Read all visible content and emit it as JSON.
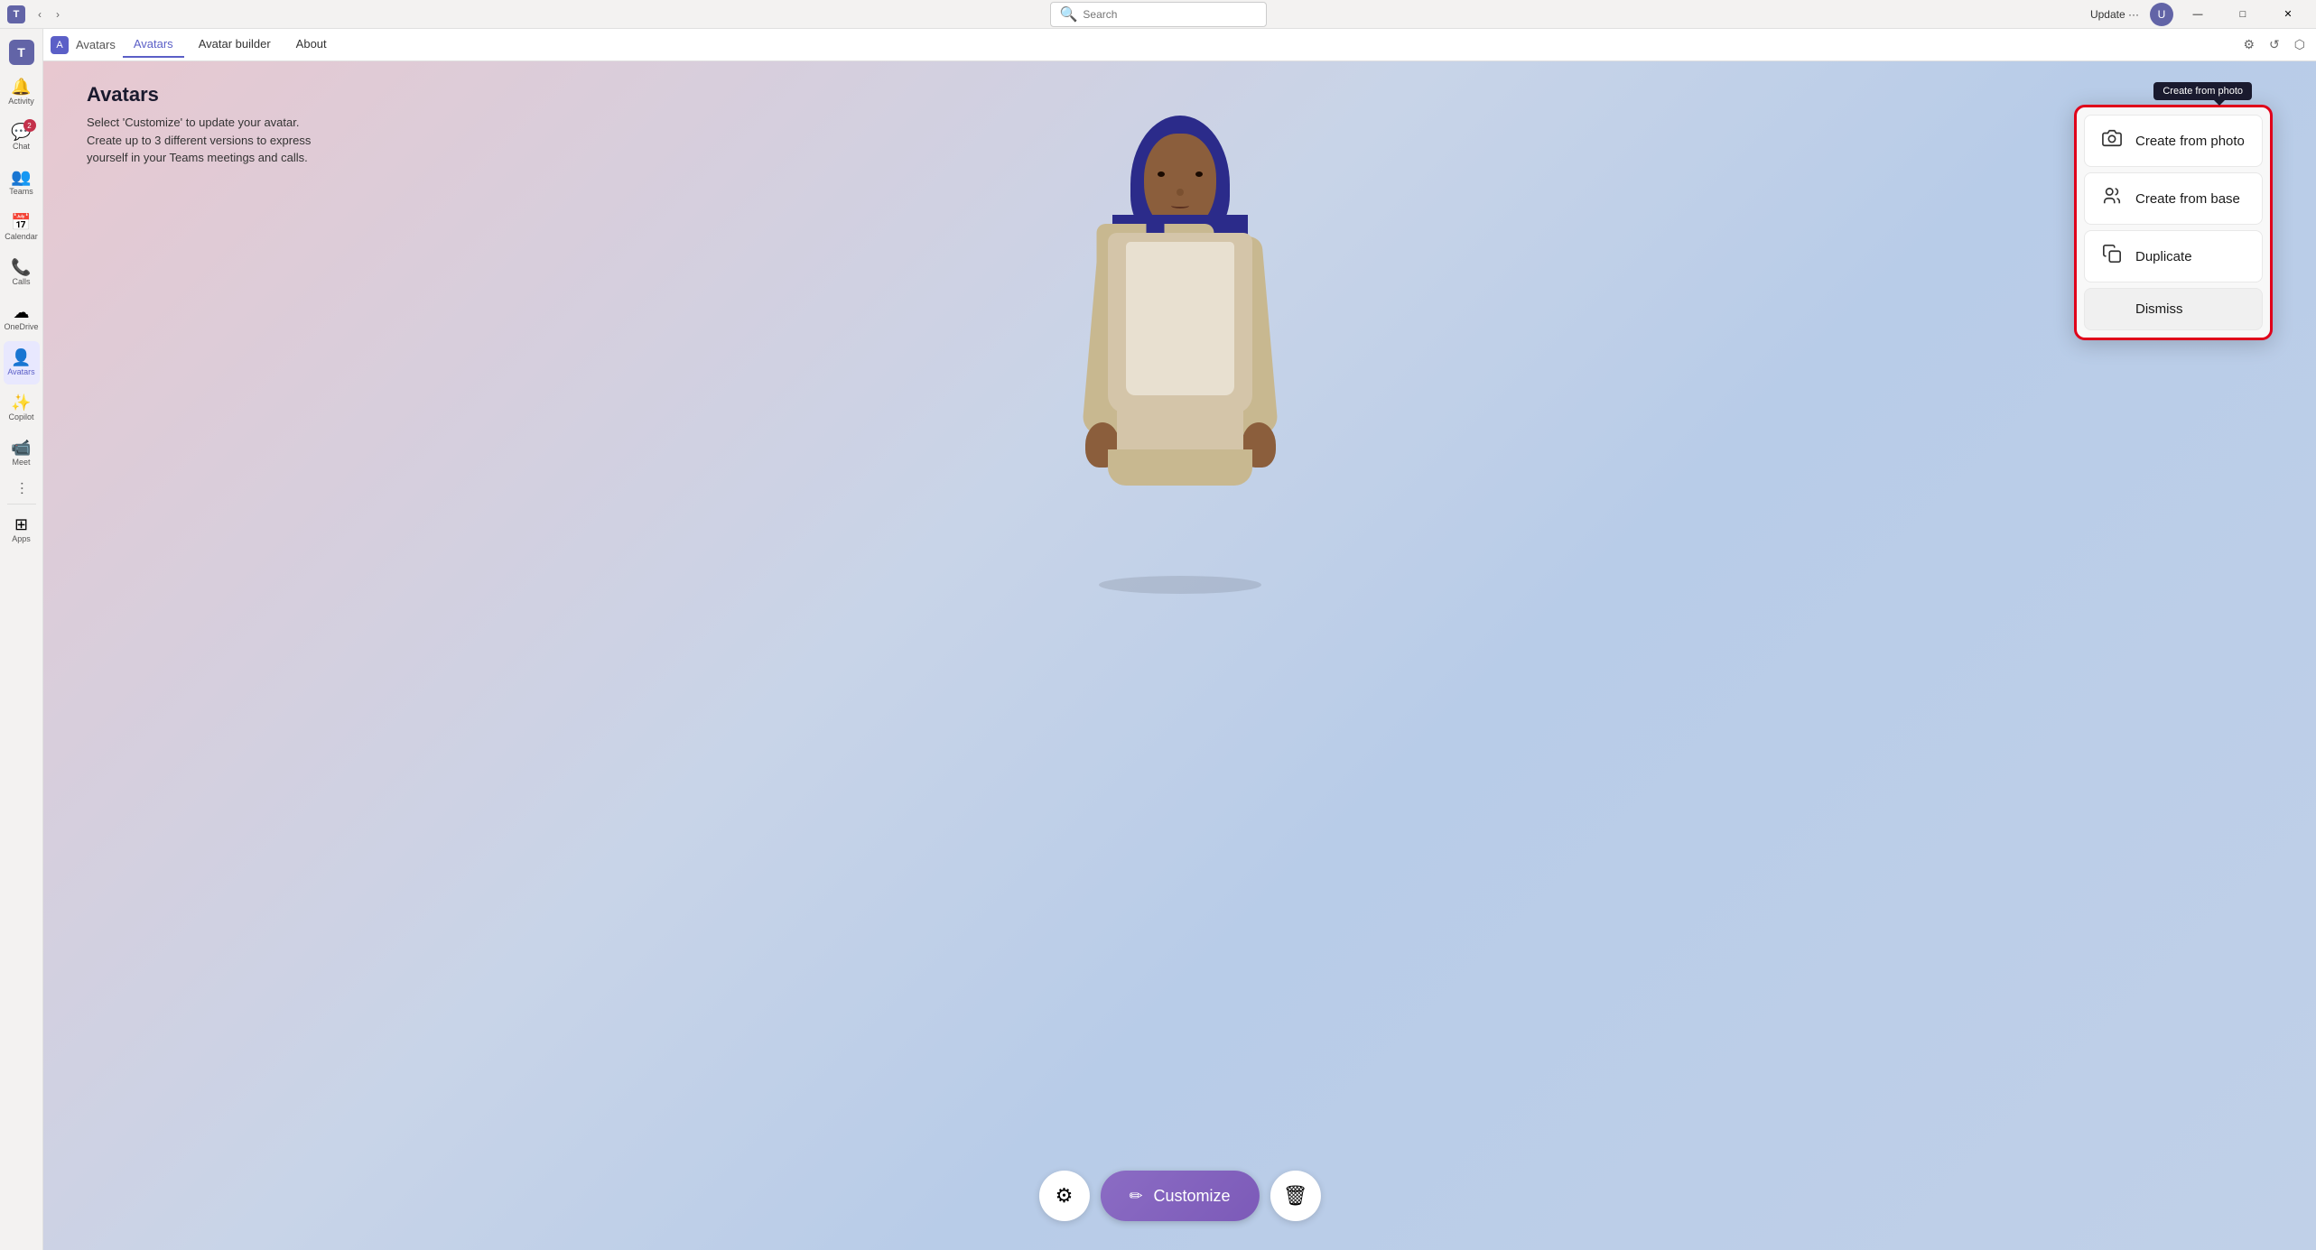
{
  "titleBar": {
    "updateLabel": "Update ···",
    "backLabel": "‹",
    "forwardLabel": "›",
    "searchPlaceholder": "Search",
    "minimizeLabel": "—",
    "maximizeLabel": "□",
    "closeLabel": "✕"
  },
  "sidebar": {
    "items": [
      {
        "id": "app-icon",
        "icon": "🪟",
        "label": "",
        "badge": null
      },
      {
        "id": "activity",
        "icon": "🔔",
        "label": "Activity",
        "badge": null
      },
      {
        "id": "chat",
        "icon": "💬",
        "label": "Chat",
        "badge": "2"
      },
      {
        "id": "teams",
        "icon": "👥",
        "label": "Teams",
        "badge": null
      },
      {
        "id": "calendar",
        "icon": "📅",
        "label": "Calendar",
        "badge": null
      },
      {
        "id": "calls",
        "icon": "📞",
        "label": "Calls",
        "badge": null
      },
      {
        "id": "onedrive",
        "icon": "☁",
        "label": "OneDrive",
        "badge": null
      },
      {
        "id": "avatars",
        "icon": "👤",
        "label": "Avatars",
        "badge": null,
        "active": true
      },
      {
        "id": "copilot",
        "icon": "✨",
        "label": "Copilot",
        "badge": null
      },
      {
        "id": "meet",
        "icon": "📹",
        "label": "Meet",
        "badge": null
      },
      {
        "id": "apps",
        "icon": "⊞",
        "label": "Apps",
        "badge": null
      }
    ]
  },
  "tabs": {
    "breadcrumb": "Avatars",
    "items": [
      {
        "id": "avatars-tab",
        "label": "Avatars",
        "active": true
      },
      {
        "id": "avatar-builder-tab",
        "label": "Avatar builder",
        "active": false
      },
      {
        "id": "about-tab",
        "label": "About",
        "active": false
      }
    ]
  },
  "page": {
    "title": "Avatars",
    "description": "Select 'Customize' to update your avatar.\nCreate up to 3 different versions to express\nyourself in your Teams meetings and calls."
  },
  "toolbar": {
    "settingsLabel": "⚙",
    "customizeLabel": "Customize",
    "customizeIcon": "✏",
    "deleteLabel": "🗑"
  },
  "contextMenu": {
    "tooltip": "Create from photo",
    "items": [
      {
        "id": "create-from-photo",
        "icon": "📷",
        "label": "Create from photo"
      },
      {
        "id": "create-from-base",
        "icon": "👥",
        "label": "Create from base"
      },
      {
        "id": "duplicate",
        "icon": "📋",
        "label": "Duplicate"
      },
      {
        "id": "dismiss",
        "icon": "",
        "label": "Dismiss"
      }
    ]
  }
}
